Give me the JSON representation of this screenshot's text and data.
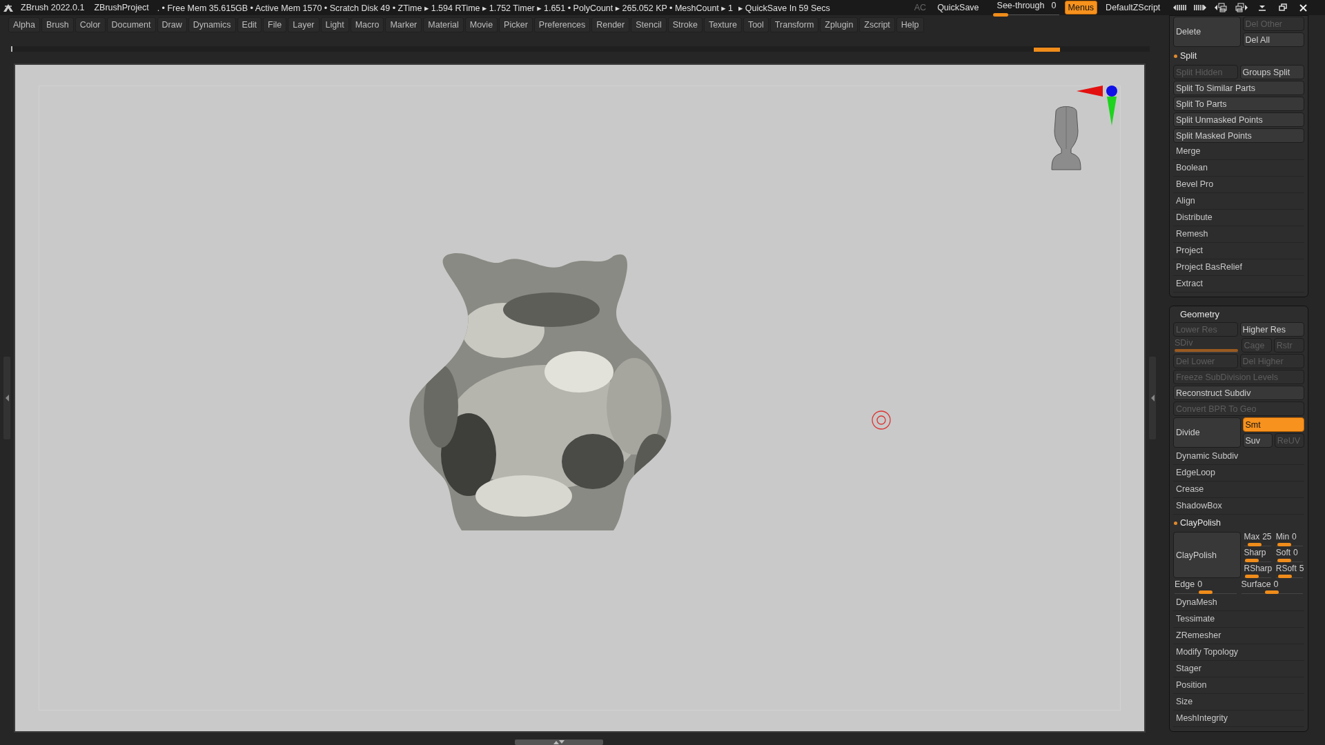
{
  "title_bar": {
    "app": "ZBrush 2022.0.1",
    "project": "ZBrushProject",
    "status": ". • Free Mem 35.615GB • Active Mem 1570 • Scratch Disk 49 •  ZTime ▸ 1.594 RTime ▸ 1.752 Timer ▸ 1.651 • PolyCount ▸ 265.052 KP  • MeshCount ▸ 1",
    "quicksave_timer": "▸ QuickSave In 59 Secs",
    "ac": {
      "label": "AC",
      "disabled": true
    },
    "quicksave": "QuickSave",
    "see_through": {
      "label": "See-through",
      "value": "0",
      "level": 0
    },
    "menus": {
      "label": "Menus",
      "on": true
    },
    "script": "DefaultZScript"
  },
  "menu_bar": [
    "Alpha",
    "Brush",
    "Color",
    "Document",
    "Draw",
    "Dynamics",
    "Edit",
    "File",
    "Layer",
    "Light",
    "Macro",
    "Marker",
    "Material",
    "Movie",
    "Picker",
    "Preferences",
    "Render",
    "Stencil",
    "Stroke",
    "Texture",
    "Tool",
    "Transform",
    "Zplugin",
    "Zscript",
    "Help"
  ],
  "palettes": [
    {
      "rows": [
        {
          "kind": "big",
          "big": {
            "label": "Delete",
            "disabled": false,
            "on": false
          },
          "right": [
            [
              {
                "label": "Del Other",
                "disabled": true,
                "on": false
              }
            ],
            [
              {
                "label": "Del All",
                "disabled": false,
                "on": false
              }
            ]
          ]
        },
        {
          "kind": "header",
          "label": "Split"
        },
        {
          "kind": "pair",
          "buttons": [
            {
              "label": "Split Hidden",
              "disabled": true,
              "on": false
            },
            {
              "label": "Groups Split",
              "disabled": false,
              "on": false
            }
          ]
        },
        {
          "kind": "button",
          "button": {
            "label": "Split To Similar Parts",
            "disabled": false,
            "on": false
          }
        },
        {
          "kind": "button",
          "button": {
            "label": "Split To Parts",
            "disabled": false,
            "on": false
          }
        },
        {
          "kind": "button",
          "button": {
            "label": "Split Unmasked Points",
            "disabled": false,
            "on": false
          }
        },
        {
          "kind": "button",
          "button": {
            "label": "Split Masked Points",
            "disabled": false,
            "on": false
          }
        },
        {
          "kind": "item",
          "label": "Merge"
        },
        {
          "kind": "item",
          "label": "Boolean"
        },
        {
          "kind": "item",
          "label": "Bevel Pro"
        },
        {
          "kind": "item",
          "label": "Align"
        },
        {
          "kind": "item",
          "label": "Distribute"
        },
        {
          "kind": "item",
          "label": "Remesh"
        },
        {
          "kind": "item",
          "label": "Project"
        },
        {
          "kind": "item",
          "label": "Project BasRelief"
        },
        {
          "kind": "item",
          "label": "Extract"
        }
      ]
    },
    {
      "title": "Geometry",
      "rows": [
        {
          "kind": "pair",
          "buttons": [
            {
              "label": "Lower Res",
              "disabled": true,
              "on": false
            },
            {
              "label": "Higher Res",
              "disabled": false,
              "on": false
            }
          ]
        },
        {
          "kind": "sdiv",
          "slider": {
            "label": "SDiv",
            "disabled": true,
            "level": 1
          },
          "buttons": [
            {
              "label": "Cage",
              "disabled": true,
              "on": false
            },
            {
              "label": "Rstr",
              "disabled": true,
              "on": false
            }
          ]
        },
        {
          "kind": "pair",
          "buttons": [
            {
              "label": "Del Lower",
              "disabled": true,
              "on": false
            },
            {
              "label": "Del Higher",
              "disabled": true,
              "on": false
            }
          ]
        },
        {
          "kind": "button",
          "button": {
            "label": "Freeze SubDivision Levels",
            "disabled": true,
            "on": false
          }
        },
        {
          "kind": "button",
          "button": {
            "label": "Reconstruct Subdiv",
            "disabled": false,
            "on": false
          }
        },
        {
          "kind": "button",
          "button": {
            "label": "Convert BPR To Geo",
            "disabled": true,
            "on": false
          }
        },
        {
          "kind": "big",
          "big": {
            "label": "Divide",
            "disabled": false,
            "on": false
          },
          "right": [
            [
              {
                "label": "Smt",
                "disabled": false,
                "on": true
              }
            ],
            [
              {
                "label": "Suv",
                "disabled": false,
                "on": false
              },
              {
                "label": "ReUV",
                "disabled": true,
                "on": false
              }
            ]
          ]
        },
        {
          "kind": "item",
          "label": "Dynamic Subdiv"
        },
        {
          "kind": "item",
          "label": "EdgeLoop"
        },
        {
          "kind": "item",
          "label": "Crease"
        },
        {
          "kind": "item",
          "label": "ShadowBox"
        },
        {
          "kind": "header",
          "label": "ClayPolish"
        },
        {
          "kind": "big-sliders",
          "big": {
            "label": "ClayPolish",
            "disabled": false,
            "on": false
          },
          "sliders": [
            [
              {
                "label": "Max",
                "value": "25",
                "level": 0.3
              },
              {
                "label": "Min",
                "value": "0",
                "level": 0.1
              }
            ],
            [
              {
                "label": "Sharp",
                "level": 0.1
              },
              {
                "label": "Soft",
                "value": "0",
                "level": 0.1
              }
            ],
            [
              {
                "label": "RSharp",
                "level": 0.1
              },
              {
                "label": "RSoft",
                "value": "5",
                "level": 0.15
              }
            ]
          ]
        },
        {
          "kind": "sliders",
          "sliders": [
            {
              "label": "Edge",
              "value": "0",
              "level": 0.5
            },
            {
              "label": "Surface",
              "value": "0",
              "level": 0.5
            }
          ]
        },
        {
          "kind": "item",
          "label": "DynaMesh"
        },
        {
          "kind": "item",
          "label": "Tessimate"
        },
        {
          "kind": "item",
          "label": "ZRemesher"
        },
        {
          "kind": "item",
          "label": "Modify Topology"
        },
        {
          "kind": "item",
          "label": "Stager"
        },
        {
          "kind": "item",
          "label": "Position"
        },
        {
          "kind": "item",
          "label": "Size"
        },
        {
          "kind": "item",
          "label": "MeshIntegrity"
        }
      ]
    }
  ]
}
